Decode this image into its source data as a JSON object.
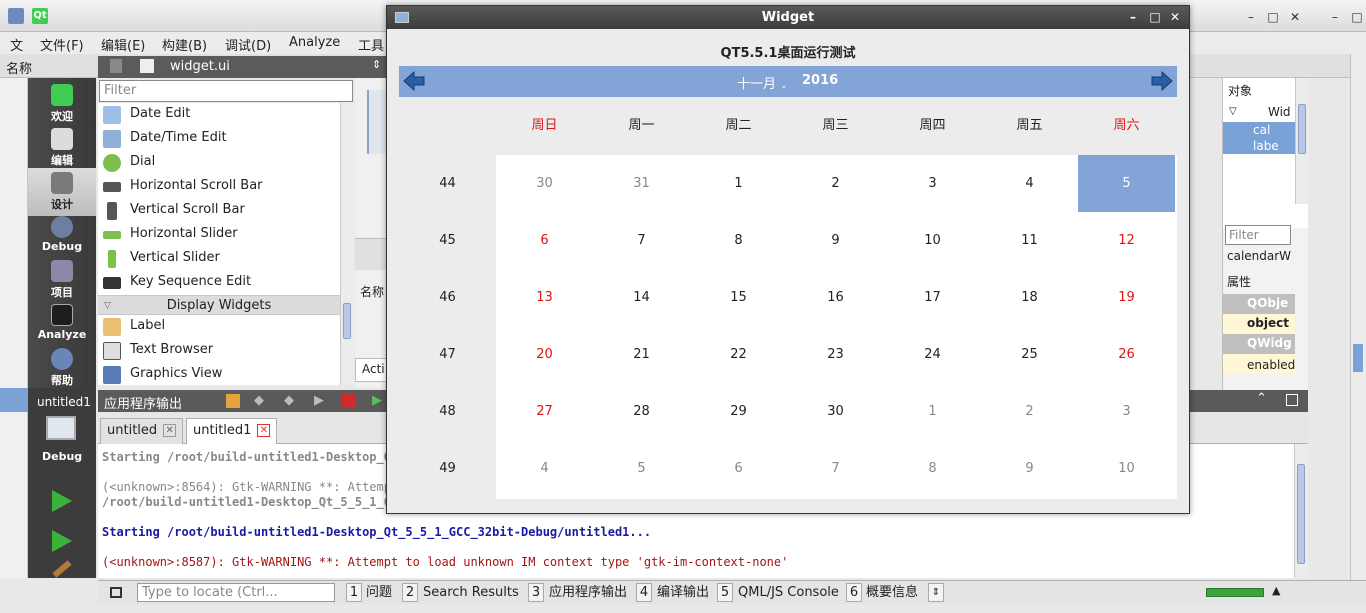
{
  "ide": {
    "menus": [
      "文",
      "文件(F)",
      "编辑(E)",
      "构建(B)",
      "调试(D)",
      "Analyze",
      "工具"
    ],
    "subbar_label": "名称",
    "modes": [
      "欢迎",
      "编辑",
      "设计",
      "Debug",
      "项目",
      "Analyze",
      "帮助"
    ],
    "target_label": "untitled1",
    "target_mode": "Debug"
  },
  "widget_box": {
    "file": "widget.ui",
    "filter_placeholder": "Filter",
    "items": [
      {
        "label": "Date Edit",
        "icon": "date-edit-icon"
      },
      {
        "label": "Date/Time Edit",
        "icon": "datetime-edit-icon"
      },
      {
        "label": "Dial",
        "icon": "dial-icon"
      },
      {
        "label": "Horizontal Scroll Bar",
        "icon": "hscrollbar-icon"
      },
      {
        "label": "Vertical Scroll Bar",
        "icon": "vscrollbar-icon"
      },
      {
        "label": "Horizontal Slider",
        "icon": "hslider-icon"
      },
      {
        "label": "Vertical Slider",
        "icon": "vslider-icon"
      },
      {
        "label": "Key Sequence Edit",
        "icon": "keyseq-icon"
      }
    ],
    "category": "Display Widgets",
    "items2": [
      {
        "label": "Label",
        "icon": "label-icon"
      },
      {
        "label": "Text Browser",
        "icon": "textbrowser-icon"
      },
      {
        "label": "Graphics View",
        "icon": "graphicsview-icon"
      }
    ]
  },
  "center": {
    "name_label": "名称",
    "action_label": "Acti"
  },
  "output": {
    "title": "应用程序输出",
    "tabs": [
      {
        "label": "untitled"
      },
      {
        "label": "untitled1"
      }
    ],
    "lines": [
      {
        "text": "Starting /root/build-untitled1-Desktop_Qt",
        "style": "gray-bold"
      },
      {
        "text": "(<unknown>:8564): Gtk-WARNING **: Attempt",
        "style": "gray"
      },
      {
        "text": "/root/build-untitled1-Desktop_Qt_5_5_1_GC",
        "style": "gray-bold"
      },
      {
        "text": "Starting /root/build-untitled1-Desktop_Qt_5_5_1_GCC_32bit-Debug/untitled1...",
        "style": "blue-bold"
      },
      {
        "text": "(<unknown>:8587): Gtk-WARNING **: Attempt to load unknown IM context type 'gtk-im-context-none'",
        "style": "darkred"
      }
    ]
  },
  "statusbar": {
    "locator_placeholder": "Type to locate (Ctrl...",
    "panes": [
      {
        "num": "1",
        "label": "问题"
      },
      {
        "num": "2",
        "label": "Search Results"
      },
      {
        "num": "3",
        "label": "应用程序输出"
      },
      {
        "num": "4",
        "label": "编译输出"
      },
      {
        "num": "5",
        "label": "QML/JS Console"
      },
      {
        "num": "6",
        "label": "概要信息"
      }
    ]
  },
  "right": {
    "objects_title": "对象",
    "tree": [
      "Wid",
      "cal",
      "labe"
    ],
    "filter_placeholder": "Filter",
    "selected_object": "calendarW",
    "props_title": "属性",
    "props": [
      "QObje",
      "object",
      "QWidg",
      "enabled"
    ]
  },
  "dialog": {
    "title": "Widget",
    "label": "QT5.5.1桌面运行测试",
    "month": "十一月",
    "year": "2016",
    "headers": [
      {
        "text": "周日",
        "red": true
      },
      {
        "text": "周一",
        "red": false
      },
      {
        "text": "周二",
        "red": false
      },
      {
        "text": "周三",
        "red": false
      },
      {
        "text": "周四",
        "red": false
      },
      {
        "text": "周五",
        "red": false
      },
      {
        "text": "周六",
        "red": true
      }
    ],
    "weeks": [
      "44",
      "45",
      "46",
      "47",
      "48",
      "49"
    ],
    "days": [
      [
        "30",
        "31",
        "1",
        "2",
        "3",
        "4",
        "5"
      ],
      [
        "6",
        "7",
        "8",
        "9",
        "10",
        "11",
        "12"
      ],
      [
        "13",
        "14",
        "15",
        "16",
        "17",
        "18",
        "19"
      ],
      [
        "20",
        "21",
        "22",
        "23",
        "24",
        "25",
        "26"
      ],
      [
        "27",
        "28",
        "29",
        "30",
        "1",
        "2",
        "3"
      ],
      [
        "4",
        "5",
        "6",
        "7",
        "8",
        "9",
        "10"
      ]
    ],
    "other_month": [
      [
        0,
        0
      ],
      [
        0,
        1
      ],
      [
        4,
        4
      ],
      [
        4,
        5
      ],
      [
        4,
        6
      ],
      [
        5,
        0
      ],
      [
        5,
        1
      ],
      [
        5,
        2
      ],
      [
        5,
        3
      ],
      [
        5,
        4
      ],
      [
        5,
        5
      ],
      [
        5,
        6
      ]
    ],
    "selected": [
      0,
      6
    ],
    "colors": {
      "accent": "#83a4d6",
      "weekend": "#e01414",
      "other_month": "#888888"
    }
  }
}
